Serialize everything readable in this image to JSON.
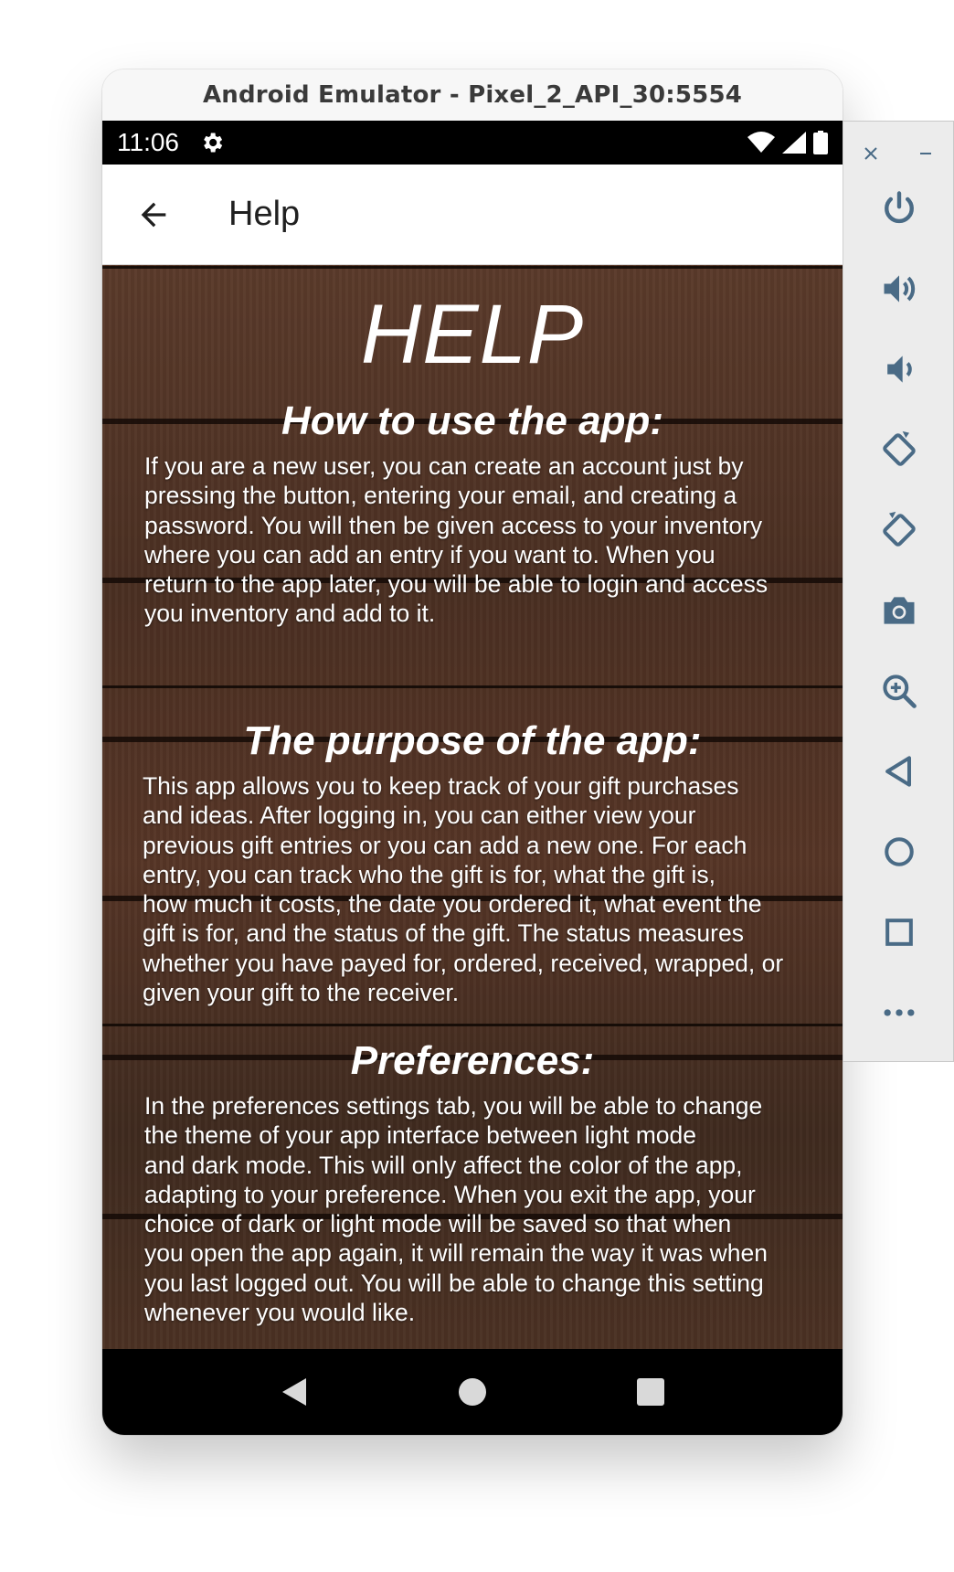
{
  "window": {
    "title": "Android Emulator - Pixel_2_API_30:5554"
  },
  "status_bar": {
    "time": "11:06"
  },
  "app_bar": {
    "title": "Help"
  },
  "content": {
    "heading": "HELP",
    "sections": [
      {
        "title": "How to use the app:",
        "body": "If you are a new user, you can create an account just by\npressing the button, entering your email, and creating a\npassword. You will then be given access to your inventory\nwhere you can add an entry if you want to. When you\nreturn to the app later, you will be able to login and access\nyou inventory and add to it."
      },
      {
        "title": "The purpose of the app:",
        "body": "This app allows you to keep track of your gift purchases\nand ideas. After logging in, you can either view your\nprevious gift entries or you can add a new one. For each\nentry, you can track who the gift is for, what the gift is,\nhow much it costs, the date you ordered it, what event the\ngift is for, and the status of the gift. The status measures\nwhether you have payed for, ordered, received, wrapped, or\ngiven your gift to the receiver."
      },
      {
        "title": "Preferences:",
        "body": "In the preferences settings tab, you will be able to change\nthe theme of your app interface between light mode\nand dark mode. This will only affect the color of the app,\nadapting to your preference. When you exit the app, your\nchoice of dark or light mode will be saved so that when\nyou open the app again, it will remain the way it was when\nyou last logged out. You will be able to change this setting\nwhenever you would like."
      }
    ]
  },
  "nav_bar": {
    "buttons": [
      "back-icon",
      "home-icon",
      "recents-icon"
    ]
  },
  "side_toolbar": {
    "window_controls": [
      "close-icon",
      "minimize-icon"
    ],
    "buttons": [
      "power-icon",
      "volume-up-icon",
      "volume-down-icon",
      "rotate-left-icon",
      "rotate-right-icon",
      "camera-icon",
      "zoom-icon",
      "back-icon",
      "home-icon",
      "overview-icon",
      "more-icon"
    ]
  },
  "colors": {
    "status_bar": "#000000",
    "app_bar": "#ffffff",
    "text": "#ffffff",
    "wood": "#4a2f22",
    "toolbar_icon": "#4a6b86"
  }
}
